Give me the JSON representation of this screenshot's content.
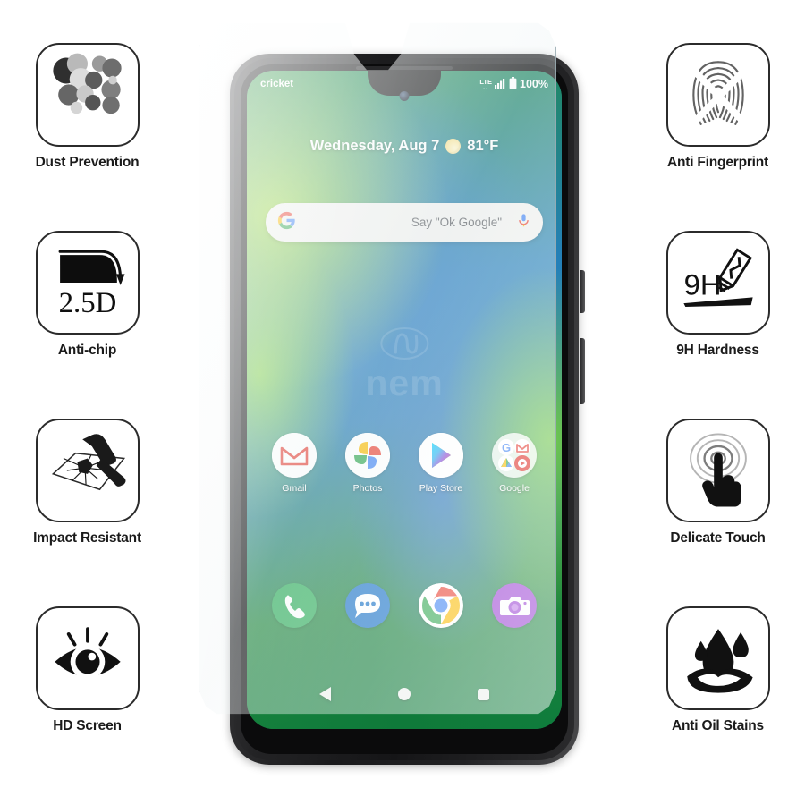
{
  "product": {
    "watermark_text": "nem"
  },
  "features_left": [
    {
      "icon": "dust-particles-icon",
      "label": "Dust Prevention"
    },
    {
      "icon": "curved-edge-2-5d-icon",
      "label": "Anti-chip",
      "badge": "2.5D"
    },
    {
      "icon": "hammer-breaking-glass-icon",
      "label": "Impact Resistant"
    },
    {
      "icon": "eye-rays-icon",
      "label": "HD Screen"
    }
  ],
  "features_right": [
    {
      "icon": "fingerprint-crossed-icon",
      "label": "Anti Fingerprint"
    },
    {
      "icon": "knife-scratch-icon",
      "label": "9H Hardness",
      "badge": "9H"
    },
    {
      "icon": "pointing-hand-ripple-icon",
      "label": "Delicate Touch"
    },
    {
      "icon": "oil-droplet-icon",
      "label": "Anti Oil Stains"
    }
  ],
  "phone": {
    "status_bar": {
      "carrier": "cricket",
      "network": "LTE",
      "network_sub": "↕",
      "signal_icon": "signal-bars-icon",
      "battery_icon": "battery-full-icon",
      "battery_percent": "100%"
    },
    "date_widget": {
      "date": "Wednesday, Aug 7",
      "weather_icon": "sun-icon",
      "temperature": "81°F"
    },
    "search_bar": {
      "logo_icon": "google-g-icon",
      "hint": "Say \"Ok Google\"",
      "mic_icon": "microphone-icon"
    },
    "app_row": [
      {
        "icon": "gmail-icon",
        "label": "Gmail"
      },
      {
        "icon": "google-photos-icon",
        "label": "Photos"
      },
      {
        "icon": "play-store-icon",
        "label": "Play Store"
      },
      {
        "icon": "google-folder-icon",
        "label": "Google"
      }
    ],
    "dock": [
      {
        "icon": "phone-dialer-icon",
        "label": "Phone"
      },
      {
        "icon": "messages-icon",
        "label": "Messages"
      },
      {
        "icon": "chrome-icon",
        "label": "Chrome"
      },
      {
        "icon": "camera-icon",
        "label": "Camera"
      }
    ],
    "nav_bar": [
      {
        "icon": "back-triangle-icon",
        "label": "Back"
      },
      {
        "icon": "home-circle-icon",
        "label": "Home"
      },
      {
        "icon": "recents-square-icon",
        "label": "Recents"
      }
    ],
    "side_buttons": [
      {
        "name": "power-button"
      },
      {
        "name": "volume-button"
      }
    ]
  },
  "colors": {
    "wallpaper_green": "#1f8a4d",
    "wallpaper_blue": "#2480b8",
    "icon_outline": "#2b2b2b",
    "label_text": "#1b1b1b",
    "gmail_red": "#e5443a",
    "phone_green": "#2dad5a",
    "messages_blue": "#1a73c8",
    "camera_purple": "#9b3fd4"
  }
}
